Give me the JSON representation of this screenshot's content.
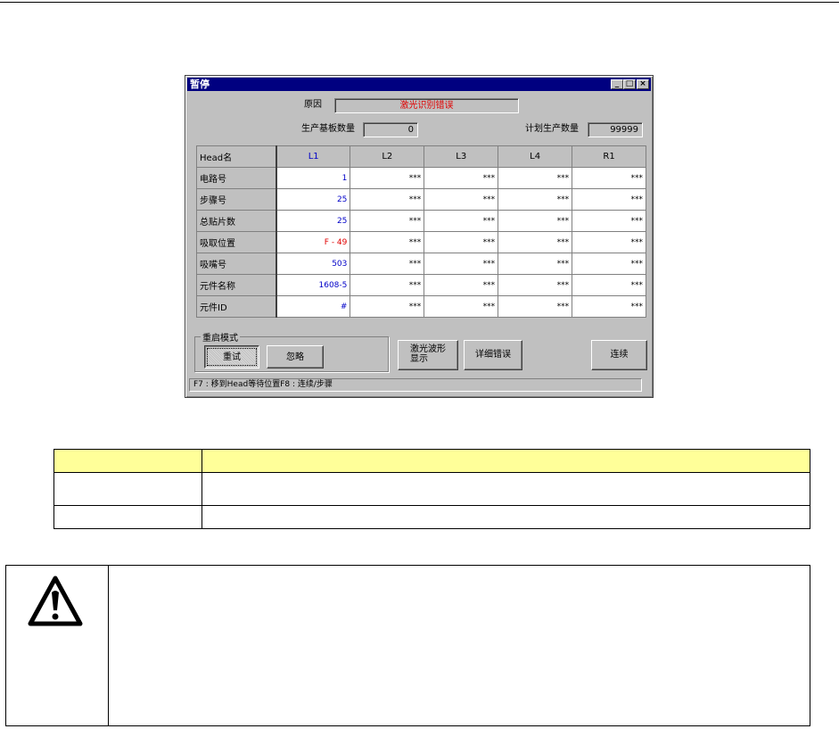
{
  "dialog": {
    "title": "暂停",
    "reason_label": "原因",
    "reason_value": "激光识别错误",
    "produced_label": "生产基板数量",
    "produced_value": "0",
    "planned_label": "计划生产数量",
    "planned_value": "99999"
  },
  "grid": {
    "columns": [
      "Head名",
      "L1",
      "L2",
      "L3",
      "L4",
      "R1"
    ],
    "rows": [
      {
        "label": "电路号",
        "values": [
          "1",
          "***",
          "***",
          "***",
          "***"
        ]
      },
      {
        "label": "步骤号",
        "values": [
          "25",
          "***",
          "***",
          "***",
          "***"
        ]
      },
      {
        "label": "总贴片数",
        "values": [
          "25",
          "***",
          "***",
          "***",
          "***"
        ]
      },
      {
        "label": "吸取位置",
        "values": [
          "F - 49",
          "***",
          "***",
          "***",
          "***"
        ]
      },
      {
        "label": "吸嘴号",
        "values": [
          "503",
          "***",
          "***",
          "***",
          "***"
        ]
      },
      {
        "label": "元件名称",
        "values": [
          "1608-5",
          "***",
          "***",
          "***",
          "***"
        ]
      },
      {
        "label": "元件ID",
        "values": [
          "#",
          "***",
          "***",
          "***",
          "***"
        ]
      }
    ]
  },
  "restart_mode": {
    "legend": "重启模式",
    "retry_label": "重试",
    "skip_label": "忽略"
  },
  "buttons": {
    "laser_wave_line1": "激光波形",
    "laser_wave_line2": "显示",
    "detail_error": "详细错误",
    "continue": "连续"
  },
  "status_bar": "F7 : 移到Head等待位置F8 : 连续/步骤",
  "colors": {
    "title_bar": "#000080",
    "reason_text": "#e00000",
    "l1_values": "#0000c8",
    "table_header_bg": "#ffff99"
  },
  "icons": [
    "minimize-icon",
    "maximize-icon",
    "close-icon",
    "warning-icon"
  ]
}
